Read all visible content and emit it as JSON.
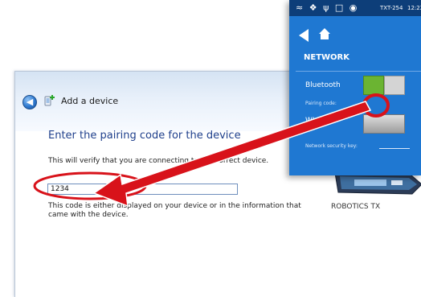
{
  "dialog": {
    "title": "Add a device",
    "heading": "Enter the pairing code for the device",
    "verify_text": "This will verify that you are connecting to the correct device.",
    "code_value": "1234",
    "description": "This code is either displayed on your device or in the information that came with the device.",
    "device_name": "ROBOTICS TX"
  },
  "phone": {
    "status_device": "TXT-254",
    "status_time": "12:22",
    "screen_title": "NETWORK",
    "bluetooth_label": "Bluetooth",
    "pairing_label": "Pairing code:",
    "wifi_label": "WLAN",
    "network_key_label": "Network security key:"
  },
  "icons": {
    "back": "back-arrow-icon",
    "add_device": "add-device-icon",
    "home": "home-icon",
    "wifi": "wifi-icon",
    "bluetooth": "bluetooth-icon",
    "usb": "usb-icon",
    "stop": "stop-icon",
    "motor": "motor-icon"
  },
  "colors": {
    "phone_bg": "#1f78d2",
    "status_bar": "#0d3e79",
    "heading": "#1e3f8c",
    "arrow": "#d8121a",
    "toggle_on": "#6bb432"
  }
}
